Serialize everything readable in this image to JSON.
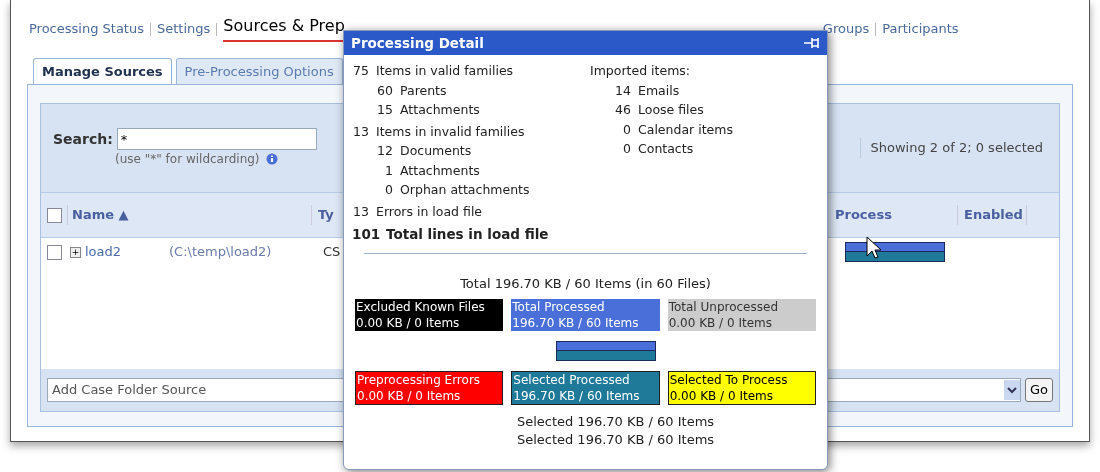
{
  "nav": [
    {
      "label": "Processing Status",
      "selected": false
    },
    {
      "label": "Settings",
      "selected": false
    },
    {
      "label": "Sources & Prep",
      "selected": true
    },
    {
      "label": "Groups",
      "selected": false
    },
    {
      "label": "Participants",
      "selected": false
    }
  ],
  "tabs": [
    {
      "label": "Manage Sources",
      "selected": true
    },
    {
      "label": "Pre-Processing Options",
      "selected": false
    }
  ],
  "search": {
    "label": "Search:",
    "value": "*",
    "hint": "(use \"*\" for wildcarding)"
  },
  "showing": "Showing 2 of 2; 0 selected",
  "table": {
    "all_checked": false,
    "columns": [
      "Name ▲",
      "Ty",
      "Process",
      "Enabled"
    ],
    "rows": [
      {
        "checked": false,
        "expand": "+",
        "name": "load2",
        "path": "(C:\\temp\\load2)",
        "type": "CS"
      }
    ]
  },
  "add_source": {
    "value": "Add Case Folder Source",
    "button": "Go"
  },
  "popup": {
    "title": "Processing Detail",
    "left": [
      {
        "num": "75",
        "label": "Items in valid families",
        "children": [
          {
            "num": "60",
            "label": "Parents"
          },
          {
            "num": "15",
            "label": "Attachments"
          }
        ]
      },
      {
        "num": "13",
        "label": "Items in invalid families",
        "children": [
          {
            "num": "12",
            "label": "Documents"
          },
          {
            "num": "1",
            "label": "Attachments"
          },
          {
            "num": "0",
            "label": "Orphan attachments"
          }
        ]
      },
      {
        "num": "13",
        "label": "Errors in load file"
      }
    ],
    "total": {
      "num": "101",
      "label": "Total lines in load file"
    },
    "imported": {
      "label": "Imported items:",
      "items": [
        {
          "num": "14",
          "label": "Emails"
        },
        {
          "num": "46",
          "label": "Loose files"
        },
        {
          "num": "0",
          "label": "Calendar items"
        },
        {
          "num": "0",
          "label": "Contacts"
        }
      ]
    },
    "summary": "Total 196.70 KB / 60 Items (in 60 Files)",
    "boxes": [
      {
        "title": "Excluded Known Files",
        "value": "0.00 KB / 0 Items",
        "color": "#000000"
      },
      {
        "title": "Total Processed",
        "value": "196.70 KB / 60 Items",
        "color": "#4a6fd8"
      },
      {
        "title": "Total Unprocessed",
        "value": "0.00 KB / 0 Items",
        "color": "#cccccc"
      },
      {
        "title": "Preprocessing Errors",
        "value": "0.00 KB / 0 Items",
        "color": "#ff0000"
      },
      {
        "title": "Selected Processed",
        "value": "196.70 KB / 60 Items",
        "color": "#1f7a99"
      },
      {
        "title": "Selected To Process",
        "value": "0.00 KB / 0 Items",
        "color": "#ffff00"
      }
    ],
    "selected_lines": [
      "Selected 196.70 KB / 60 Items",
      "Selected 196.70 KB / 60 Items"
    ]
  }
}
